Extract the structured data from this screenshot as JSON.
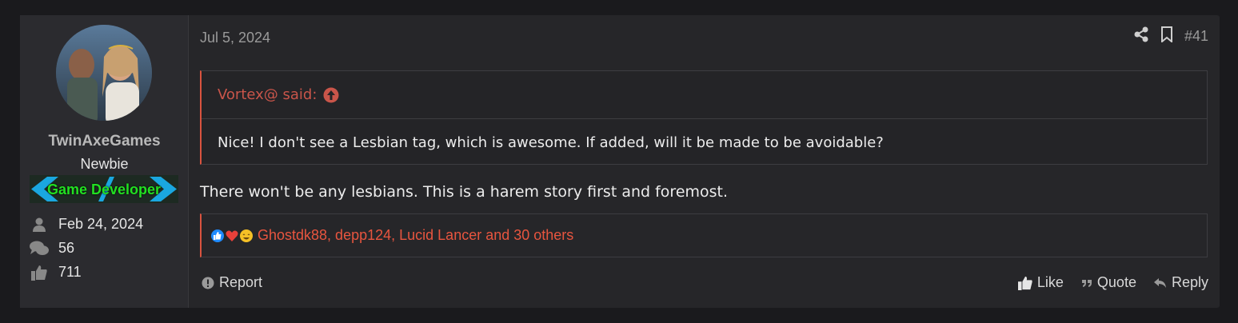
{
  "user": {
    "name": "TwinAxeGames",
    "title": "Newbie",
    "banner": "Game Developer",
    "joined": "Feb 24, 2024",
    "messages": "56",
    "reaction_score": "711"
  },
  "post": {
    "date": "Jul 5, 2024",
    "number": "#41",
    "quote_author": "Vortex@ said:",
    "quote_text": "Nice! I don't see a Lesbian tag, which is awesome. If added, will it be made to be avoidable?",
    "message": "There won't be any lesbians. This is a harem story first and foremost.",
    "reactions_text": "Ghostdk88, depp124, Lucid Lancer and 30 others"
  },
  "actions": {
    "report": "Report",
    "like": "Like",
    "quote": "Quote",
    "reply": "Reply"
  },
  "icons": [
    "share-icon",
    "bookmark-icon",
    "arrow-up-circle-icon",
    "user-icon",
    "comments-icon",
    "thumbs-up-icon",
    "alert-icon",
    "quote-mark-icon",
    "reply-icon",
    "like-reaction-icon",
    "love-reaction-icon",
    "haha-reaction-icon"
  ],
  "colors": {
    "accent": "#d9533f",
    "banner_text": "#22e022",
    "banner_arrows": "#1aa7e0",
    "background": "#1a1a1d",
    "panel": "#262629"
  }
}
